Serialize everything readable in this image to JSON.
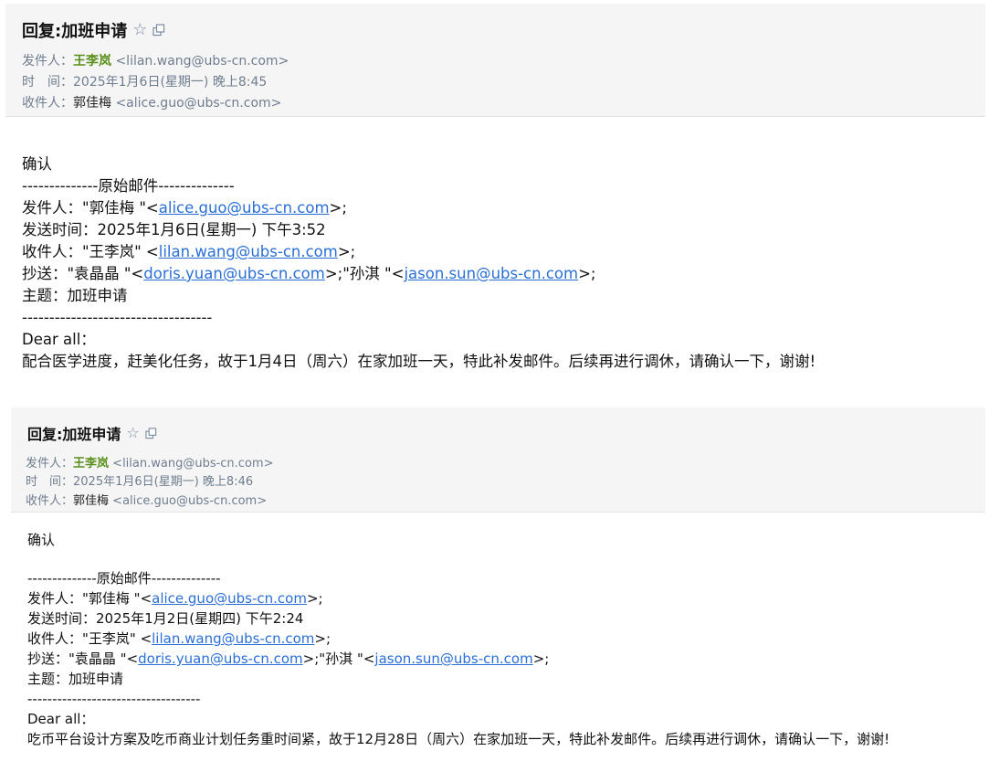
{
  "emails": [
    {
      "subject": "回复:加班申请",
      "star_icon": "star-outline-icon",
      "popout_icon": "popout-window-icon",
      "from_label": "发件人：",
      "from_name": "王李岚",
      "from_email": "<lilan.wang@ubs-cn.com>",
      "time_label": "时　间：",
      "time_value": "2025年1月6日(星期一) 晚上8:45",
      "to_label": "收件人：",
      "to_name": "郭佳梅",
      "to_email": "<alice.guo@ubs-cn.com>",
      "body": {
        "reply": "确认",
        "separator_top": "--------------原始邮件--------------",
        "orig_from_prefix": "发件人：\"郭佳梅 \"<",
        "orig_from_email": "alice.guo@ubs-cn.com",
        "orig_from_suffix": ">;",
        "orig_time": "发送时间：2025年1月6日(星期一) 下午3:52",
        "orig_to_prefix": "收件人：\"王李岚\" <",
        "orig_to_email": "lilan.wang@ubs-cn.com",
        "orig_to_suffix": ">;",
        "orig_cc_prefix": "抄送：\"袁晶晶 \"<",
        "orig_cc_email1": "doris.yuan@ubs-cn.com",
        "orig_cc_middle": ">;\"孙淇 \"<",
        "orig_cc_email2": "jason.sun@ubs-cn.com",
        "orig_cc_suffix": ">;",
        "orig_subject": "主题：加班申请",
        "separator_bottom": "-----------------------------------",
        "greeting": "Dear all：",
        "message": "配合医学进度，赶美化任务，故于1月4日（周六）在家加班一天，特此补发邮件。后续再进行调休，请确认一下，谢谢!"
      }
    },
    {
      "subject": "回复:加班申请",
      "star_icon": "star-outline-icon",
      "popout_icon": "popout-window-icon",
      "from_label": "发件人：",
      "from_name": "王李岚",
      "from_email": "<lilan.wang@ubs-cn.com>",
      "time_label": "时　间：",
      "time_value": "2025年1月6日(星期一) 晚上8:46",
      "to_label": "收件人：",
      "to_name": "郭佳梅",
      "to_email": "<alice.guo@ubs-cn.com>",
      "body": {
        "reply": "确认",
        "separator_top": "--------------原始邮件--------------",
        "orig_from_prefix": "发件人：\"郭佳梅 \"<",
        "orig_from_email": "alice.guo@ubs-cn.com",
        "orig_from_suffix": ">;",
        "orig_time": "发送时间：2025年1月2日(星期四) 下午2:24",
        "orig_to_prefix": "收件人：\"王李岚\" <",
        "orig_to_email": "lilan.wang@ubs-cn.com",
        "orig_to_suffix": ">;",
        "orig_cc_prefix": "抄送：\"袁晶晶 \"<",
        "orig_cc_email1": "doris.yuan@ubs-cn.com",
        "orig_cc_middle": ">;\"孙淇 \"<",
        "orig_cc_email2": "jason.sun@ubs-cn.com",
        "orig_cc_suffix": ">;",
        "orig_subject": "主题：加班申请",
        "separator_bottom": "-----------------------------------",
        "greeting": "Dear all：",
        "message": "吃币平台设计方案及吃币商业计划任务重时间紧，故于12月28日（周六）在家加班一天，特此补发邮件。后续再进行调休，请确认一下，谢谢!"
      }
    }
  ],
  "colors": {
    "header_bg": "#f5f5f5",
    "meta_text": "#6f7d8f",
    "sender_name": "#5a8f1c",
    "link": "#2a6fd6"
  }
}
